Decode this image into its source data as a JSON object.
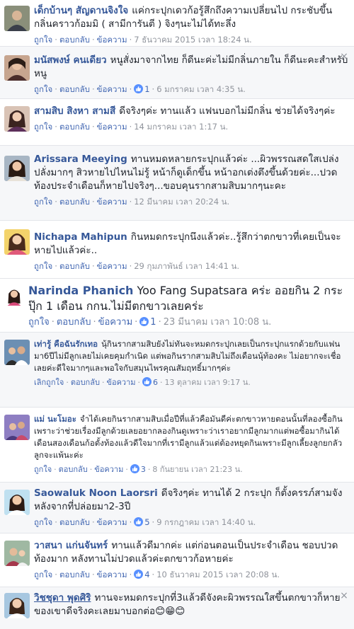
{
  "comments": [
    {
      "author": "เด็กบ้านๆ สัญดานจิงใจ",
      "text": "แค่กระปุกเดวก้อรู้สึกถึงความเปลี่ยนไป กระชับขึ้นกลิ่นคราวก้อมมิ ( สามีการันตี ) จิงๆนะไม่ได้ทะลึ่ง",
      "like": "ถูกใจ",
      "reply": "ตอบกลับ",
      "message": "ข้อความ",
      "likes": "",
      "time": "7 ธันวาคม 2015 เวลา 18:24 น."
    },
    {
      "author": "มนัสพงษ์ คนเดียว",
      "text": "หนูสั่งมาจากไทย ก็ดีนะค่ะไม่มีกลิ่นภายใน ก็ดีนะคะสำหรับหนู",
      "like": "ถูกใจ",
      "reply": "ตอบกลับ",
      "message": "ข้อความ",
      "likes": "1",
      "time": "6 มกราคม เวลา 4:35 น."
    },
    {
      "author": "สามสิบ สิงหา สามสี",
      "text": "ดีจริงๆค่ะ ทานแล้ว แฟนบอกไม่มีกลิ่น ช่วยได้จริงๆค่ะ",
      "like": "ถูกใจ",
      "reply": "ตอบกลับ",
      "message": "ข้อความ",
      "likes": "",
      "time": "14 มกราคม เวลา 1:17 น."
    },
    {
      "author": "Arissara Meeying",
      "text": "ทานหมดหลายกระปุกแล้วค่ะ ...ผิวพรรณสดใสเปล่งปลั่งมากๆ สิวหายไปไหนไม่รู้ หน้าก็ดูเด็กขึ้น หน้าอกเต่งตึงขึ้นด้วยค่ะ...ปวดท้องประจำเดือนก็หายไปจริงๆ...ขอบคุนรากสามสิบมากๆนะคะ",
      "like": "ถูกใจ",
      "reply": "ตอบกลับ",
      "message": "ข้อความ",
      "likes": "",
      "time": "12 มีนาคม เวลา 20:24 น."
    },
    {
      "author": "Nichapa Mahipun",
      "text": "กินหมดกระปุกนึงแล้วค่ะ..รู้สึกว่าตกขาวที่เคยเป็นจะหายไปแล้วค่ะ..",
      "like": "ถูกใจ",
      "reply": "ตอบกลับ",
      "message": "ข้อความ",
      "likes": "",
      "time": "29 กุมภาพันธ์ เวลา 14:41 น."
    },
    {
      "author": "Narinda Phanich",
      "text": "Yoo Fang Supatsara คร่ะ ออยกิน 2 กระปุ๊ก 1 เดือน กกน.ไม่มีตกขาวเลยคร่ะ",
      "like": "ถูกใจ",
      "reply": "ตอบกลับ",
      "message": "ข้อความ",
      "likes": "1",
      "time": "23 มีนาคม เวลา 10:08 น."
    },
    {
      "author": "เท่ารู้ คือฉันรักเทอ",
      "text": "นุ้กินรากสามสิบยังไม่ทันจะหมดกระปุกเลยเป็นกระปุกแรกด้วยกับแฟนมา6ปีไม่มีลูกเลยไม่เคยคุมกำเนิด แต่พอกินรากสามสิบไม่ถึงเดือนนุ้ท้องคะ ไม่อยากจะเชื่อเลยค่ะดีใจมากๆและพอใจกับสมุนไพรคุณสัมฤทธิ์มากๆค่ะ",
      "like": "เลิกถูกใจ",
      "reply": "ตอบกลับ",
      "message": "ข้อความ",
      "likes": "6",
      "time": "13 ตุลาคม เวลา 9:17 น."
    },
    {
      "author": "แม่ นะโมอะ",
      "text": "จำได้เคยกินรากสามสิบเมื่อปีที่แล้วคือมันดีค่ะตกขาวหายตอนนั้นที่ลองซื้อกินเพราะว่าช่วยเรื่องมีลูกด้วยเลยอยากลองกินดูเพราะว่าเราอยากมีลูกมากแต่พอซื้อมากินได้เดือนสองเดือนก้อตั้งท้องแล้วดีใจมากที่เรามีลูกแล้วแต่ต้องหยุดกินเพราะมีลูกเลี้ยงลูกยกลัวลูกจะแพ้นะค่ะ",
      "like": "ถูกใจ",
      "reply": "ตอบกลับ",
      "message": "ข้อความ",
      "likes": "3",
      "time": "8 กันยายน เวลา 21:23 น."
    },
    {
      "author": "Saowaluk Noon Laorsri",
      "text": "ดีจริงๆค่ะ ทานได้ 2 กระปุก ก็ตั้งครรภ์สามจังหลังจากที่ปล่อยมา2-3ปี",
      "like": "ถูกใจ",
      "reply": "ตอบกลับ",
      "message": "ข้อความ",
      "likes": "5",
      "time": "9 กรกฎาคม เวลา 14:40 น."
    },
    {
      "author": "วาสนา แก่นจันทร์",
      "text": "ทานแล้วดีมากค่ะ แต่ก่อนตอนเป็นประจำเดือน ชอบปวดท้องมาก หลังทานไม่ปวดแล้วค่ะตกขาวก้อหายค่ะ",
      "like": "ถูกใจ",
      "reply": "ตอบกลับ",
      "message": "ข้อความ",
      "likes": "4",
      "time": "10 ธันวาคม 2015 เวลา 20:08 น."
    },
    {
      "author": "วิชชุดา พุดศิริ",
      "text": "ทานจะหมดกระปุกที่3แล้วดีจังคะผิวพรรณใสขึ้นตกขาวก็หายของเขาดีจริงคะเลยมาบอกต่อ😊😁😊",
      "like": "",
      "reply": "",
      "message": "",
      "likes": "",
      "time": ""
    }
  ],
  "close_glyph": "×",
  "colors": {
    "link": "#365899",
    "action": "#4267b2",
    "meta": "#90949c",
    "like_badge": "#5890ff"
  }
}
